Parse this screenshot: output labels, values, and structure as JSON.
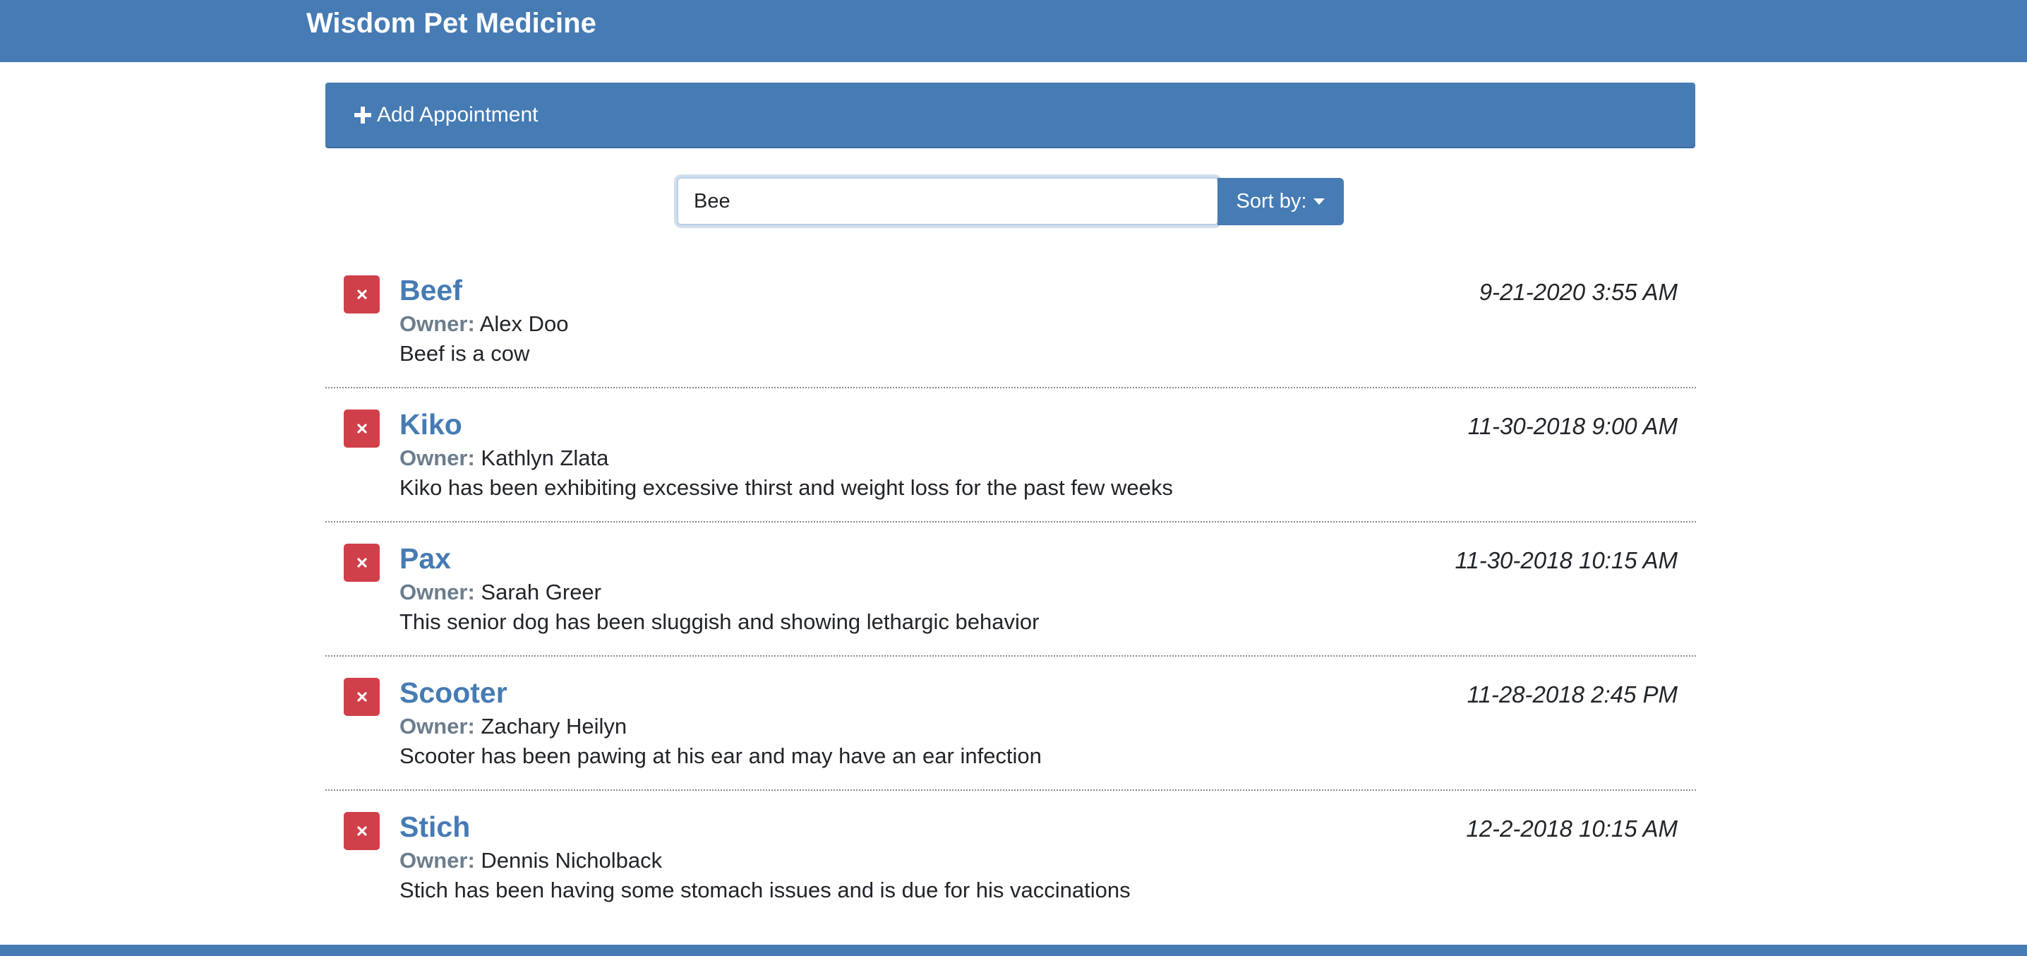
{
  "header": {
    "brand": "Wisdom Pet Medicine"
  },
  "add_panel": {
    "label": "Add Appointment",
    "icon": "plus-icon"
  },
  "search": {
    "value": "Bee"
  },
  "sort": {
    "label": "Sort by:",
    "icon": "caret-down-icon"
  },
  "appointments": [
    {
      "pet_name": "Beef",
      "owner_label": "Owner:",
      "owner": "Alex Doo",
      "date": "9-21-2020 3:55 AM",
      "notes": "Beef is a cow"
    },
    {
      "pet_name": "Kiko",
      "owner_label": "Owner:",
      "owner": "Kathlyn Zlata",
      "date": "11-30-2018 9:00 AM",
      "notes": "Kiko has been exhibiting excessive thirst and weight loss for the past few weeks"
    },
    {
      "pet_name": "Pax",
      "owner_label": "Owner:",
      "owner": "Sarah Greer",
      "date": "11-30-2018 10:15 AM",
      "notes": "This senior dog has been sluggish and showing lethargic behavior"
    },
    {
      "pet_name": "Scooter",
      "owner_label": "Owner:",
      "owner": "Zachary Heilyn",
      "date": "11-28-2018 2:45 PM",
      "notes": "Scooter has been pawing at his ear and may have an ear infection"
    },
    {
      "pet_name": "Stich",
      "owner_label": "Owner:",
      "owner": "Dennis Nicholback",
      "date": "12-2-2018 10:15 AM",
      "notes": "Stich has been having some stomach issues and is due for his vaccinations"
    }
  ],
  "colors": {
    "primary": "#467bb4",
    "danger": "#d0404a",
    "owner_label": "#6c7d8c"
  }
}
